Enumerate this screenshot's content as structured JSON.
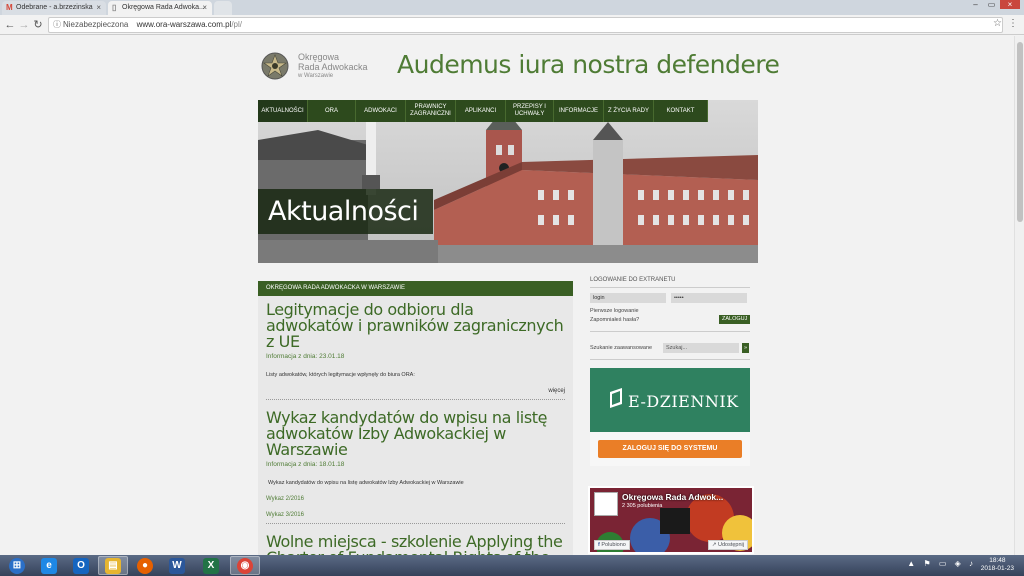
{
  "browser": {
    "tabs": [
      {
        "label": "Odebrane - a.brzezinska",
        "icon": "gmail-icon"
      },
      {
        "label": "Okręgowa Rada Adwoka...",
        "icon": "page-icon"
      }
    ],
    "security_label": "Niezabezpieczona",
    "url_host": "www.ora-warszawa.com.pl",
    "url_path": "/pl/"
  },
  "site": {
    "logo_line1": "Okręgowa",
    "logo_line2": "Rada Adwokacka",
    "logo_line3": "w Warszawie",
    "motto": "Audemus iura nostra defendere",
    "hero_title": "Aktualności",
    "nav": [
      {
        "label": "AKTUALNOŚCI"
      },
      {
        "label": "ORA"
      },
      {
        "label": "ADWOKACI"
      },
      {
        "label": "PRAWNICY ZAGRANICZNI"
      },
      {
        "label": "APLIKANCI"
      },
      {
        "label": "PRZEPISY I UCHWAŁY"
      },
      {
        "label": "INFORMACJE"
      },
      {
        "label": "Z ŻYCIA RADY"
      },
      {
        "label": "KONTAKT"
      }
    ]
  },
  "content": {
    "header": "OKRĘGOWA RADA ADWOKACKA W WARSZAWIE",
    "articles": [
      {
        "title": "Legitymacje do odbioru dla adwokatów i prawników zagranicznych z UE",
        "date": "Informacja z dnia: 23.01.18",
        "text": "Listy adwokatów, których legitymacje wpłynęły do biura ORA:",
        "more": "więcej"
      },
      {
        "title": "Wykaz kandydatów do wpisu na listę adwokatów Izby Adwokackiej w Warszawie",
        "date": "Informacja z dnia: 18.01.18",
        "text": "Wykaz kandydatów do wpisu na listę adwokatów Izby Adwokackiej w Warszawie",
        "link1": "Wykaz 2/2016",
        "link2": "Wykaz 3/2016"
      },
      {
        "title": "Wolne miejsca - szkolenie Applying the Charter of Fundamental Rights of the European Union\""
      }
    ]
  },
  "sidebar": {
    "login_title": "LOGOWANIE DO EXTRANETU",
    "login_value": "login",
    "password_value": "•••••",
    "first_login": "Pierwsze logowanie",
    "forgot_password": "Zapomniałeś hasła?",
    "login_button": "ZALOGUJ",
    "advanced_search": "Szukanie zaawansowane",
    "search_placeholder": "Szukaj...",
    "search_go": "»",
    "ediary_title": "E-DZIENNIK",
    "ediary_button": "ZALOGUJ SIĘ DO SYSTEMU",
    "fb_name": "Okręgowa Rada Adwok...",
    "fb_likes": "2 305 polubienia",
    "fb_like": "Polubiono",
    "fb_share": "Udostępnij"
  },
  "taskbar": {
    "time": "18:48",
    "date": "2018-01-23",
    "apps": [
      {
        "name": "start-button",
        "glyph": "⊞",
        "color": "#2b6fc7"
      },
      {
        "name": "ie-icon",
        "glyph": "e",
        "color": "#1e88e5"
      },
      {
        "name": "outlook-icon",
        "glyph": "O",
        "color": "#1565c0"
      },
      {
        "name": "explorer-icon",
        "glyph": "▤",
        "color": "#e6b530"
      },
      {
        "name": "firefox-icon",
        "glyph": "●",
        "color": "#e66000"
      },
      {
        "name": "word-icon",
        "glyph": "W",
        "color": "#2b579a"
      },
      {
        "name": "excel-icon",
        "glyph": "X",
        "color": "#217346"
      },
      {
        "name": "chrome-icon",
        "glyph": "◉",
        "color": "#db4437"
      }
    ]
  }
}
